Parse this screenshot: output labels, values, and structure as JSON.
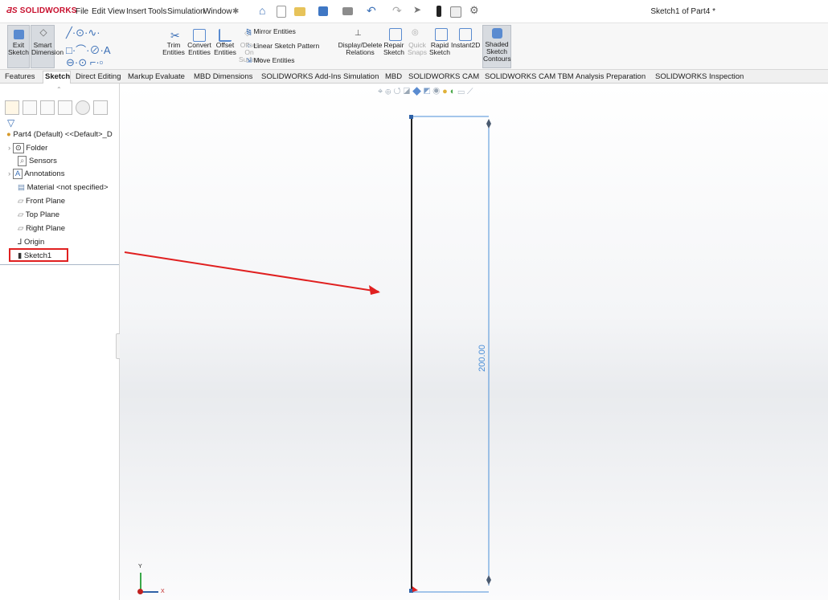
{
  "app": {
    "logo": "SOLIDWORKS",
    "title": "Sketch1 of Part4 *"
  },
  "menu": [
    "File",
    "Edit",
    "View",
    "Insert",
    "Tools",
    "Simulation",
    "Window"
  ],
  "toolbar": {
    "exit_sketch": "Exit Sketch",
    "smart_dimension": "Smart Dimension",
    "trim": "Trim Entities",
    "convert": "Convert Entities",
    "offset": "Offset Entities",
    "offset_surface": "Offset On Surface",
    "mirror": "Mirror Entities",
    "linear_pattern": "Linear Sketch Pattern",
    "move": "Move Entities",
    "display_delete": "Display/Delete Relations",
    "repair": "Repair Sketch",
    "quick_snaps": "Quick Snaps",
    "rapid_sketch": "Rapid Sketch",
    "instant2d": "Instant2D",
    "shaded_contours": "Shaded Sketch Contours"
  },
  "tabs": [
    "Features",
    "Sketch",
    "Direct Editing",
    "Markup",
    "Evaluate",
    "MBD Dimensions",
    "SOLIDWORKS Add-Ins",
    "Simulation",
    "MBD",
    "SOLIDWORKS CAM",
    "SOLIDWORKS CAM TBM",
    "Analysis Preparation",
    "SOLIDWORKS Inspection"
  ],
  "active_tab": "Sketch",
  "tree": {
    "root": "Part4 (Default) <<Default>_D",
    "items": [
      "Folder",
      "Sensors",
      "Annotations",
      "Material <not specified>",
      "Front Plane",
      "Top Plane",
      "Right Plane",
      "Origin",
      "Sketch1"
    ],
    "selected": "Sketch1"
  },
  "sketch": {
    "dimension": "200.00"
  },
  "triad": {
    "x": "X",
    "y": "Y"
  },
  "colors": {
    "accent": "#c8102e",
    "highlight": "#e02020",
    "dimension": "#4a8fd8",
    "tab_active_bg": "#ffffff"
  }
}
